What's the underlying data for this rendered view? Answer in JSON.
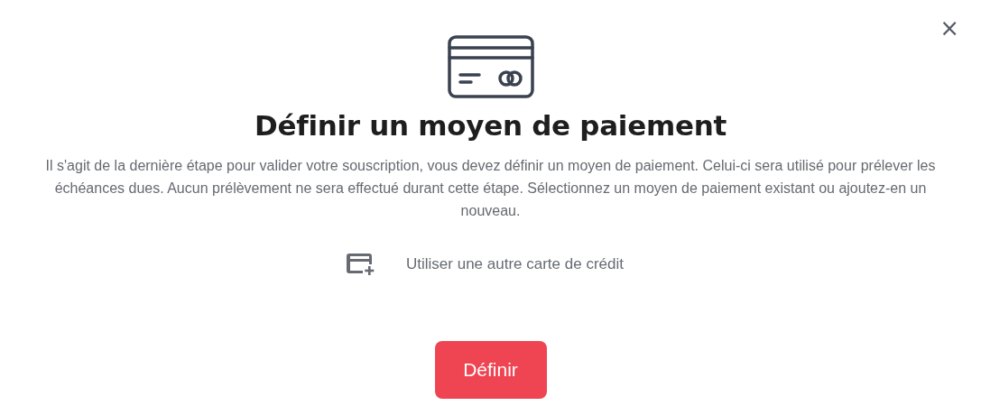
{
  "dialog": {
    "close": "×",
    "title": "Définir un moyen de paiement",
    "description": "Il s'agit de la dernière étape pour valider votre souscription, vous devez définir un moyen de paiement. Celui-ci sera utilisé pour prélever les échéances dues. Aucun prélèvement ne sera effectué durant cette étape. Sélectionnez un moyen de paiement existant ou ajoutez-en un nouveau.",
    "options": [
      {
        "kind": "new_card",
        "label": "Utiliser une autre carte de crédit"
      }
    ],
    "submit": "Définir"
  }
}
